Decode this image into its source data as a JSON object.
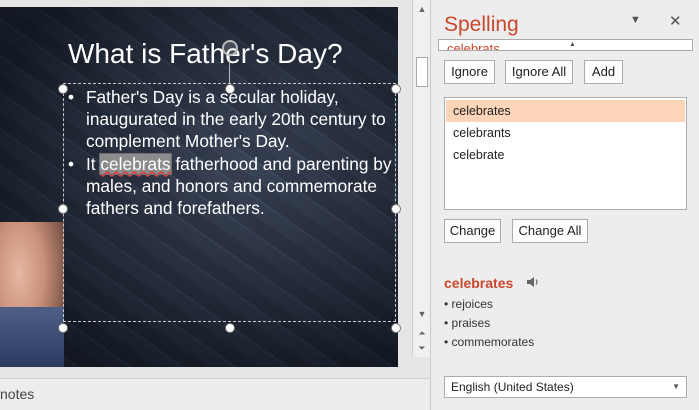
{
  "slide": {
    "title": "What is Father's Day?",
    "bullet1": "Father's Day is a secular holiday, inaugurated in the early 20th century to complement Mother's Day.",
    "bullet2_pre": "It ",
    "bullet2_misspelled": "celebrats",
    "bullet2_post": " fatherhood and parenting by males, and honors and commemorate fathers and forefathers."
  },
  "notes_label": "notes",
  "pane": {
    "title": "Spelling",
    "not_in_dictionary": "celebrats",
    "buttons": {
      "ignore": "Ignore",
      "ignore_all": "Ignore All",
      "add": "Add",
      "change": "Change",
      "change_all": "Change All"
    },
    "suggestions": [
      "celebrates",
      "celebrants",
      "celebrate"
    ],
    "definition": {
      "word": "celebrates",
      "synonyms": [
        "rejoices",
        "praises",
        "commemorates"
      ]
    },
    "language": "English (United States)"
  },
  "colors": {
    "accent": "#c9472c",
    "selection": "#fcd4b8"
  }
}
